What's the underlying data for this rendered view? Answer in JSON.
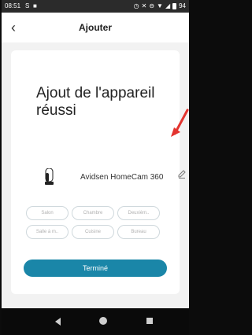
{
  "status_bar": {
    "time": "08:51",
    "battery": "94"
  },
  "header": {
    "title": "Ajouter"
  },
  "card": {
    "heading_line1": "Ajout de l'appareil",
    "heading_line2": "réussi",
    "device_name": "Avidsen HomeCam 360"
  },
  "rooms": [
    "Salon",
    "Chambre",
    "Deuxièm..",
    "Salle à m..",
    "Cuisine",
    "Bureau"
  ],
  "done_button": "Terminé",
  "colors": {
    "accent": "#1a86a8",
    "annotation_arrow": "#e3342f"
  },
  "icons": [
    "back-arrow-icon",
    "camera-icon",
    "pencil-icon",
    "nav-back-icon",
    "nav-home-icon",
    "nav-recent-icon"
  ]
}
